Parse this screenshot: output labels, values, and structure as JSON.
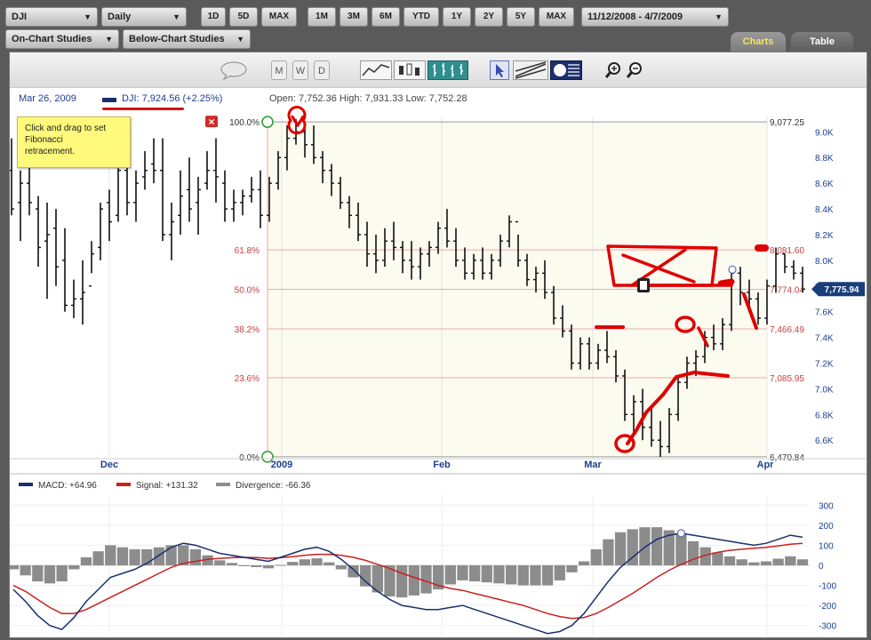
{
  "toolbar": {
    "symbol": "DJI",
    "interval": "Daily",
    "range_buttons": [
      "1D",
      "5D",
      "MAX"
    ],
    "period_buttons": [
      "1M",
      "3M",
      "6M",
      "YTD",
      "1Y",
      "2Y",
      "5Y",
      "MAX"
    ],
    "date_range": "11/12/2008 - 4/7/2009",
    "on_chart_studies": "On-Chart Studies",
    "below_chart_studies": "Below-Chart Studies"
  },
  "tabs": {
    "charts": "Charts",
    "table": "Table"
  },
  "icon_bar": {
    "icons": [
      "chat-bubble-icon",
      "period-m-icon",
      "period-w-icon",
      "period-d-icon",
      "line-chart-icon",
      "candle-chart-icon",
      "bar-chart-icon",
      "pointer-icon",
      "trendline-icon",
      "fibonacci-icon",
      "zoom-in-icon",
      "zoom-out-icon"
    ],
    "period_letters": [
      "M",
      "W",
      "D"
    ]
  },
  "info": {
    "date": "Mar 26, 2009",
    "dji": "DJI: 7,924.56 (+2.25%)",
    "ohlc": "Open: 7,752.36   High: 7,931.33   Low: 7,752.28"
  },
  "tooltip": {
    "text_lines": [
      "Click and drag to set",
      "Fibonacci",
      "retracement."
    ]
  },
  "macd_legend": {
    "macd": "MACD: +64.96",
    "signal": "Signal: +131.32",
    "divergence": "Divergence: -66.36"
  },
  "colors": {
    "macd": "#1a2f6e",
    "signal": "#cc2020",
    "divergence": "#8c8c8c",
    "fib": "#e07070",
    "annotation": "#e00000",
    "price_tag": "#1a3e7c"
  },
  "chart_data": [
    {
      "type": "ohlc-bar",
      "title": "DJI",
      "x_labels": [
        "Dec",
        "2009",
        "Feb",
        "Mar",
        "Apr"
      ],
      "y_ticks": [
        "9.0K",
        "8.8K",
        "8.6K",
        "8.4K",
        "8.2K",
        "8.0K",
        "7.8K",
        "7.6K",
        "7.4K",
        "7.2K",
        "7.0K",
        "6.8K",
        "6.6K"
      ],
      "ylim": [
        6470,
        9120
      ],
      "current_price": "7,775.94",
      "fibonacci": {
        "levels": [
          {
            "pct": "100.0%",
            "value": 9077.25,
            "label": "9,077.25"
          },
          {
            "pct": "61.8%",
            "value": 8081.6,
            "label": "8,081.60"
          },
          {
            "pct": "50.0%",
            "value": 7774.04,
            "label": "7,774.04"
          },
          {
            "pct": "38.2%",
            "value": 7466.49,
            "label": "7,466.49"
          },
          {
            "pct": "23.6%",
            "value": 7085.95,
            "label": "7,085.95"
          },
          {
            "pct": "0.0%",
            "value": 6470.84,
            "label": "6,470.84"
          }
        ]
      },
      "bars": [
        [
          8700,
          8950,
          8350,
          8400
        ],
        [
          8450,
          8700,
          8150,
          8600
        ],
        [
          8600,
          8950,
          8350,
          8450
        ],
        [
          8400,
          8500,
          7950,
          8100
        ],
        [
          8150,
          8450,
          7700,
          8200
        ],
        [
          8250,
          8400,
          7800,
          7950
        ],
        [
          8000,
          8250,
          7600,
          7650
        ],
        [
          7650,
          7850,
          7550,
          7700
        ],
        [
          7700,
          8000,
          7500,
          7750
        ],
        [
          7800,
          8150,
          7900,
          8050
        ],
        [
          8100,
          8450,
          8000,
          8400
        ],
        [
          8450,
          8550,
          8150,
          8300
        ],
        [
          8350,
          8950,
          8300,
          8700
        ],
        [
          8700,
          8800,
          8350,
          8450
        ],
        [
          8450,
          8700,
          8300,
          8600
        ],
        [
          8650,
          8850,
          8550,
          8700
        ],
        [
          8750,
          8950,
          8600,
          8700
        ],
        [
          8700,
          8950,
          8150,
          8200
        ],
        [
          8200,
          8450,
          8000,
          8300
        ],
        [
          8350,
          8700,
          8200,
          8500
        ],
        [
          8550,
          8800,
          8300,
          8400
        ],
        [
          8450,
          8650,
          8200,
          8550
        ],
        [
          8600,
          8850,
          8550,
          8700
        ],
        [
          8700,
          8950,
          8450,
          8650
        ],
        [
          8600,
          8700,
          8300,
          8400
        ],
        [
          8400,
          8550,
          8300,
          8450
        ],
        [
          8450,
          8550,
          8350,
          8500
        ],
        [
          8500,
          8650,
          8450,
          8550
        ],
        [
          8550,
          8700,
          8250,
          8350
        ],
        [
          8350,
          8650,
          8300,
          8600
        ],
        [
          8600,
          8850,
          8550,
          8800
        ],
        [
          8800,
          9050,
          8700,
          8950
        ],
        [
          8950,
          9100,
          8900,
          9000
        ],
        [
          9000,
          9077,
          8800,
          8900
        ],
        [
          8900,
          9050,
          8750,
          8800
        ],
        [
          8800,
          8850,
          8600,
          8700
        ],
        [
          8700,
          8750,
          8500,
          8600
        ],
        [
          8600,
          8650,
          8400,
          8450
        ],
        [
          8450,
          8500,
          8250,
          8350
        ],
        [
          8350,
          8450,
          8150,
          8200
        ],
        [
          8200,
          8300,
          7950,
          8050
        ],
        [
          8050,
          8200,
          7900,
          8000
        ],
        [
          8000,
          8250,
          7950,
          8150
        ],
        [
          8150,
          8300,
          8000,
          8100
        ],
        [
          8100,
          8150,
          7900,
          8000
        ],
        [
          8000,
          8150,
          7850,
          7950
        ],
        [
          7950,
          8100,
          7850,
          8050
        ],
        [
          8050,
          8150,
          7950,
          8100
        ],
        [
          8100,
          8300,
          8050,
          8250
        ],
        [
          8250,
          8400,
          8100,
          8150
        ],
        [
          8150,
          8250,
          7950,
          8000
        ],
        [
          8000,
          8100,
          7850,
          7900
        ],
        [
          7900,
          8050,
          7850,
          8000
        ],
        [
          8000,
          8100,
          7850,
          7900
        ],
        [
          7900,
          8050,
          7850,
          8000
        ],
        [
          8000,
          8200,
          7950,
          8150
        ],
        [
          8150,
          8350,
          8100,
          8300
        ],
        [
          8300,
          8200,
          7950,
          8000
        ],
        [
          8000,
          8050,
          7800,
          7850
        ],
        [
          7850,
          7950,
          7750,
          7900
        ],
        [
          7900,
          8000,
          7700,
          7750
        ],
        [
          7750,
          7800,
          7500,
          7550
        ],
        [
          7550,
          7650,
          7400,
          7450
        ],
        [
          7450,
          7500,
          7150,
          7200
        ],
        [
          7200,
          7400,
          7150,
          7350
        ],
        [
          7350,
          7400,
          7150,
          7200
        ],
        [
          7200,
          7350,
          7150,
          7300
        ],
        [
          7300,
          7450,
          7200,
          7250
        ],
        [
          7250,
          7300,
          7050,
          7100
        ],
        [
          7100,
          7150,
          6750,
          6800
        ],
        [
          6800,
          6950,
          6650,
          6900
        ],
        [
          6900,
          7000,
          6600,
          6700
        ],
        [
          6700,
          6850,
          6550,
          6600
        ],
        [
          6600,
          6750,
          6470,
          6550
        ],
        [
          6550,
          6850,
          6500,
          6800
        ],
        [
          6800,
          7100,
          6750,
          7050
        ],
        [
          7050,
          7250,
          7000,
          7200
        ],
        [
          7200,
          7300,
          7100,
          7250
        ],
        [
          7250,
          7450,
          7200,
          7400
        ],
        [
          7400,
          7500,
          7300,
          7350
        ],
        [
          7350,
          7550,
          7300,
          7500
        ],
        [
          7500,
          7950,
          7450,
          7900
        ],
        [
          7900,
          7950,
          7650,
          7750
        ],
        [
          7750,
          7850,
          7600,
          7700
        ],
        [
          7700,
          7750,
          7500,
          7550
        ],
        [
          7550,
          7850,
          7500,
          7800
        ],
        [
          7800,
          8100,
          7750,
          8050
        ],
        [
          8050,
          8050,
          7900,
          7950
        ],
        [
          7950,
          8000,
          7850,
          7900
        ],
        [
          7900,
          7950,
          7750,
          7776
        ]
      ]
    },
    {
      "type": "macd",
      "y_ticks": [
        "300",
        "200",
        "100",
        "0",
        "-100",
        "-200",
        "-300"
      ],
      "ylim": [
        -350,
        350
      ],
      "macd": [
        -120,
        -180,
        -250,
        -300,
        -320,
        -260,
        -180,
        -120,
        -60,
        -40,
        -20,
        10,
        50,
        90,
        110,
        100,
        80,
        60,
        50,
        40,
        30,
        20,
        40,
        60,
        80,
        90,
        70,
        30,
        -20,
        -80,
        -130,
        -170,
        -200,
        -210,
        -220,
        -220,
        -210,
        -200,
        -220,
        -240,
        -260,
        -280,
        -300,
        -320,
        -340,
        -330,
        -300,
        -240,
        -160,
        -80,
        -10,
        40,
        90,
        130,
        150,
        160,
        150,
        140,
        130,
        120,
        110,
        100,
        110,
        130,
        150,
        140
      ],
      "signal": [
        -100,
        -130,
        -170,
        -210,
        -240,
        -240,
        -220,
        -190,
        -160,
        -130,
        -100,
        -70,
        -40,
        -10,
        10,
        20,
        30,
        35,
        38,
        40,
        39,
        35,
        38,
        43,
        50,
        55,
        55,
        50,
        40,
        25,
        5,
        -15,
        -40,
        -60,
        -80,
        -100,
        -115,
        -125,
        -140,
        -155,
        -170,
        -185,
        -200,
        -220,
        -240,
        -255,
        -265,
        -260,
        -240,
        -210,
        -175,
        -140,
        -100,
        -60,
        -25,
        5,
        30,
        50,
        65,
        75,
        80,
        85,
        90,
        97,
        105,
        110
      ],
      "divergence": [
        -20,
        -50,
        -80,
        -90,
        -80,
        -20,
        40,
        70,
        100,
        90,
        80,
        80,
        90,
        100,
        100,
        80,
        50,
        25,
        12,
        0,
        -9,
        -15,
        2,
        17,
        30,
        35,
        15,
        -20,
        -60,
        -105,
        -135,
        -155,
        -160,
        -150,
        -140,
        -120,
        -95,
        -75,
        -80,
        -85,
        -90,
        -95,
        -100,
        -100,
        -100,
        -75,
        -35,
        20,
        80,
        130,
        165,
        180,
        190,
        190,
        175,
        155,
        120,
        90,
        65,
        45,
        30,
        15,
        20,
        33,
        45,
        30
      ]
    }
  ]
}
